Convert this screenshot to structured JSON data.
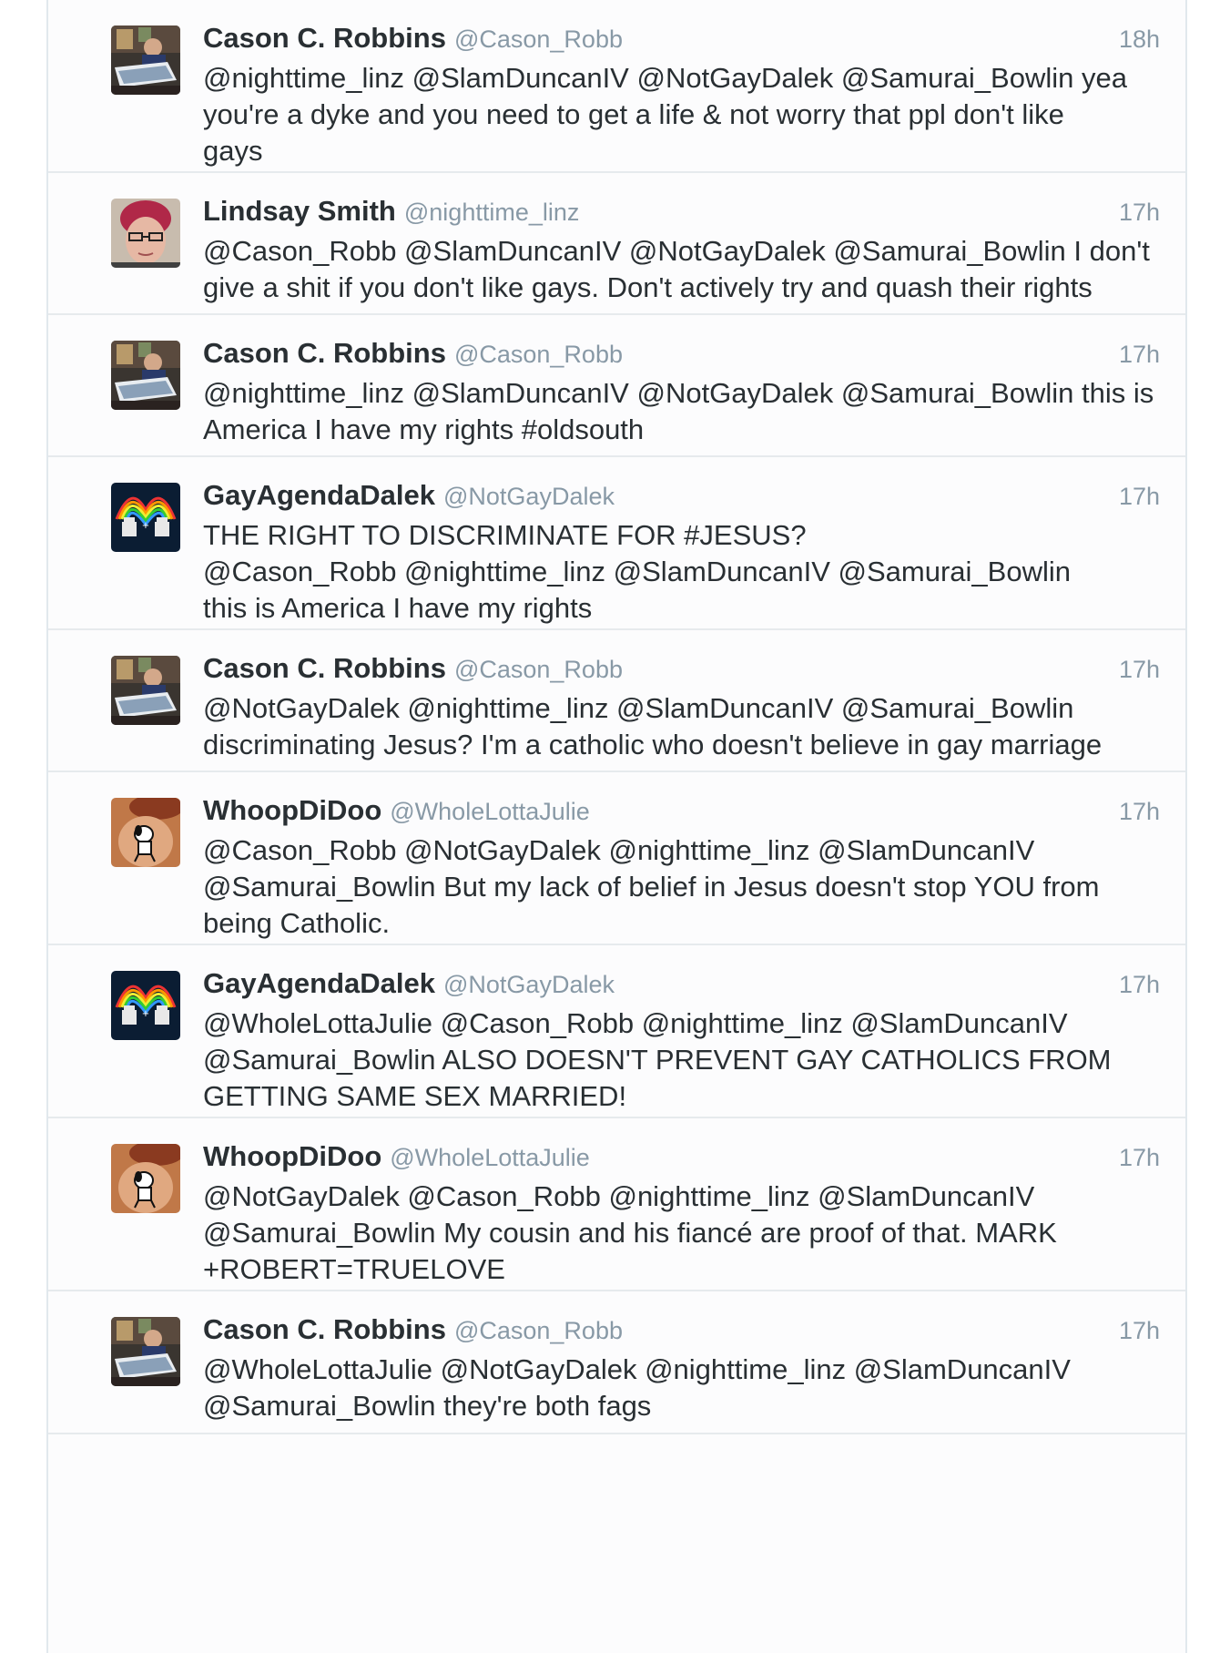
{
  "tweets": [
    {
      "name": "Cason C. Robbins",
      "handle": "@Cason_Robb",
      "time": "18h",
      "avatar": "cason-avatar",
      "text": "@nighttime_linz @SlamDuncanIV @NotGayDalek @Samurai_Bowlin yea\nyou're a dyke and you need to get a life & not worry that ppl don't like\ngays"
    },
    {
      "name": "Lindsay Smith",
      "handle": "@nighttime_linz",
      "time": "17h",
      "avatar": "lindsay-avatar",
      "text": "@Cason_Robb @SlamDuncanIV @NotGayDalek @Samurai_Bowlin I don't\ngive a shit if you don't like gays. Don't actively try and quash their rights"
    },
    {
      "name": "Cason C. Robbins",
      "handle": "@Cason_Robb",
      "time": "17h",
      "avatar": "cason-avatar",
      "text": "@nighttime_linz @SlamDuncanIV @NotGayDalek @Samurai_Bowlin this is\nAmerica I have my rights #oldsouth"
    },
    {
      "name": "GayAgendaDalek",
      "handle": "@NotGayDalek",
      "time": "17h",
      "avatar": "dalek-avatar",
      "text": "THE RIGHT TO DISCRIMINATE FOR #JESUS?\n@Cason_Robb @nighttime_linz @SlamDuncanIV @Samurai_Bowlin\nthis is America I have my rights"
    },
    {
      "name": "Cason C. Robbins",
      "handle": "@Cason_Robb",
      "time": "17h",
      "avatar": "cason-avatar",
      "text": "@NotGayDalek @nighttime_linz @SlamDuncanIV @Samurai_Bowlin\ndiscriminating Jesus? I'm a catholic who doesn't believe in gay marriage"
    },
    {
      "name": "WhoopDiDoo",
      "handle": "@WholeLottaJulie",
      "time": "17h",
      "avatar": "julie-avatar",
      "text": "@Cason_Robb @NotGayDalek @nighttime_linz @SlamDuncanIV\n@Samurai_Bowlin But my lack of belief in Jesus doesn't stop YOU from\nbeing Catholic."
    },
    {
      "name": "GayAgendaDalek",
      "handle": "@NotGayDalek",
      "time": "17h",
      "avatar": "dalek-avatar",
      "text": "@WholeLottaJulie @Cason_Robb @nighttime_linz @SlamDuncanIV\n@Samurai_Bowlin ALSO DOESN'T PREVENT GAY CATHOLICS FROM\nGETTING SAME SEX MARRIED!"
    },
    {
      "name": "WhoopDiDoo",
      "handle": "@WholeLottaJulie",
      "time": "17h",
      "avatar": "julie-avatar",
      "text": "@NotGayDalek @Cason_Robb @nighttime_linz @SlamDuncanIV\n@Samurai_Bowlin My cousin and his fiancé are proof of that. MARK\n+ROBERT=TRUELOVE"
    },
    {
      "name": "Cason C. Robbins",
      "handle": "@Cason_Robb",
      "time": "17h",
      "avatar": "cason-avatar",
      "text": "@WholeLottaJulie @NotGayDalek @nighttime_linz @SlamDuncanIV\n@Samurai_Bowlin they're both fags"
    }
  ]
}
